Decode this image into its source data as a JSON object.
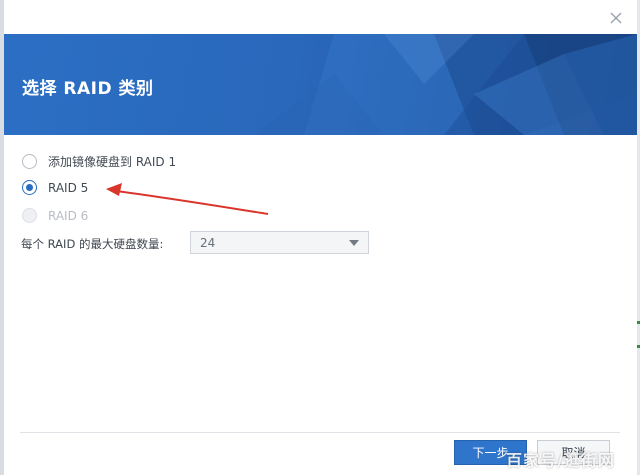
{
  "dialog": {
    "title": "选择 RAID 类别",
    "close_icon": "close-icon"
  },
  "options": [
    {
      "label": "添加镜像硬盘到 RAID 1",
      "state": "unchecked"
    },
    {
      "label": "RAID 5",
      "state": "checked"
    },
    {
      "label": "RAID 6",
      "state": "disabled"
    }
  ],
  "max_disks": {
    "label": "每个 RAID 的最大硬盘数量:",
    "value": "24",
    "icon": "chevron-down-icon"
  },
  "footer": {
    "next_label": "下一步",
    "cancel_label": "取消"
  },
  "watermark": "百家号/逛街网",
  "colors": {
    "accent": "#2a6cc0",
    "banner": "#2b6fc4",
    "arrow": "#d9352b"
  }
}
